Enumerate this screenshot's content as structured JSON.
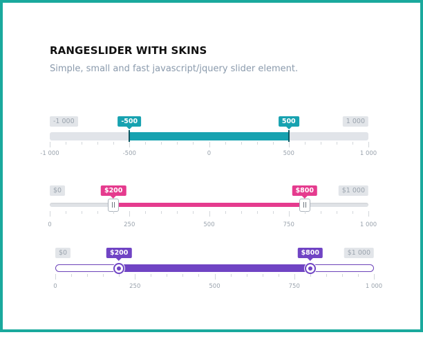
{
  "page": {
    "title": "RANGESLIDER WITH SKINS",
    "subtitle": "Simple, small and fast javascript/jquery slider element."
  },
  "sliders": [
    {
      "skin": "flat",
      "accent": "#17a2b0",
      "min": -1000,
      "max": 1000,
      "from": -500,
      "to": 500,
      "min_label": "-1 000",
      "max_label": "1 000",
      "from_label": "-500",
      "to_label": "500",
      "grid": {
        "values": [
          -1000,
          -500,
          0,
          500,
          1000
        ],
        "labels": [
          "-1 000",
          "-500",
          "0",
          "500",
          "1 000"
        ]
      }
    },
    {
      "skin": "modern",
      "accent": "#e53b8e",
      "min": 0,
      "max": 1000,
      "from": 200,
      "to": 800,
      "min_label": "$0",
      "max_label": "$1 000",
      "from_label": "$200",
      "to_label": "$800",
      "grid": {
        "values": [
          0,
          250,
          500,
          750,
          1000
        ],
        "labels": [
          "0",
          "250",
          "500",
          "750",
          "1 000"
        ]
      }
    },
    {
      "skin": "round",
      "accent": "#7044c4",
      "min": 0,
      "max": 1000,
      "from": 200,
      "to": 800,
      "min_label": "$0",
      "max_label": "$1 000",
      "from_label": "$200",
      "to_label": "$800",
      "grid": {
        "values": [
          0,
          250,
          500,
          750,
          1000
        ],
        "labels": [
          "0",
          "250",
          "500",
          "750",
          "1 000"
        ]
      }
    }
  ]
}
